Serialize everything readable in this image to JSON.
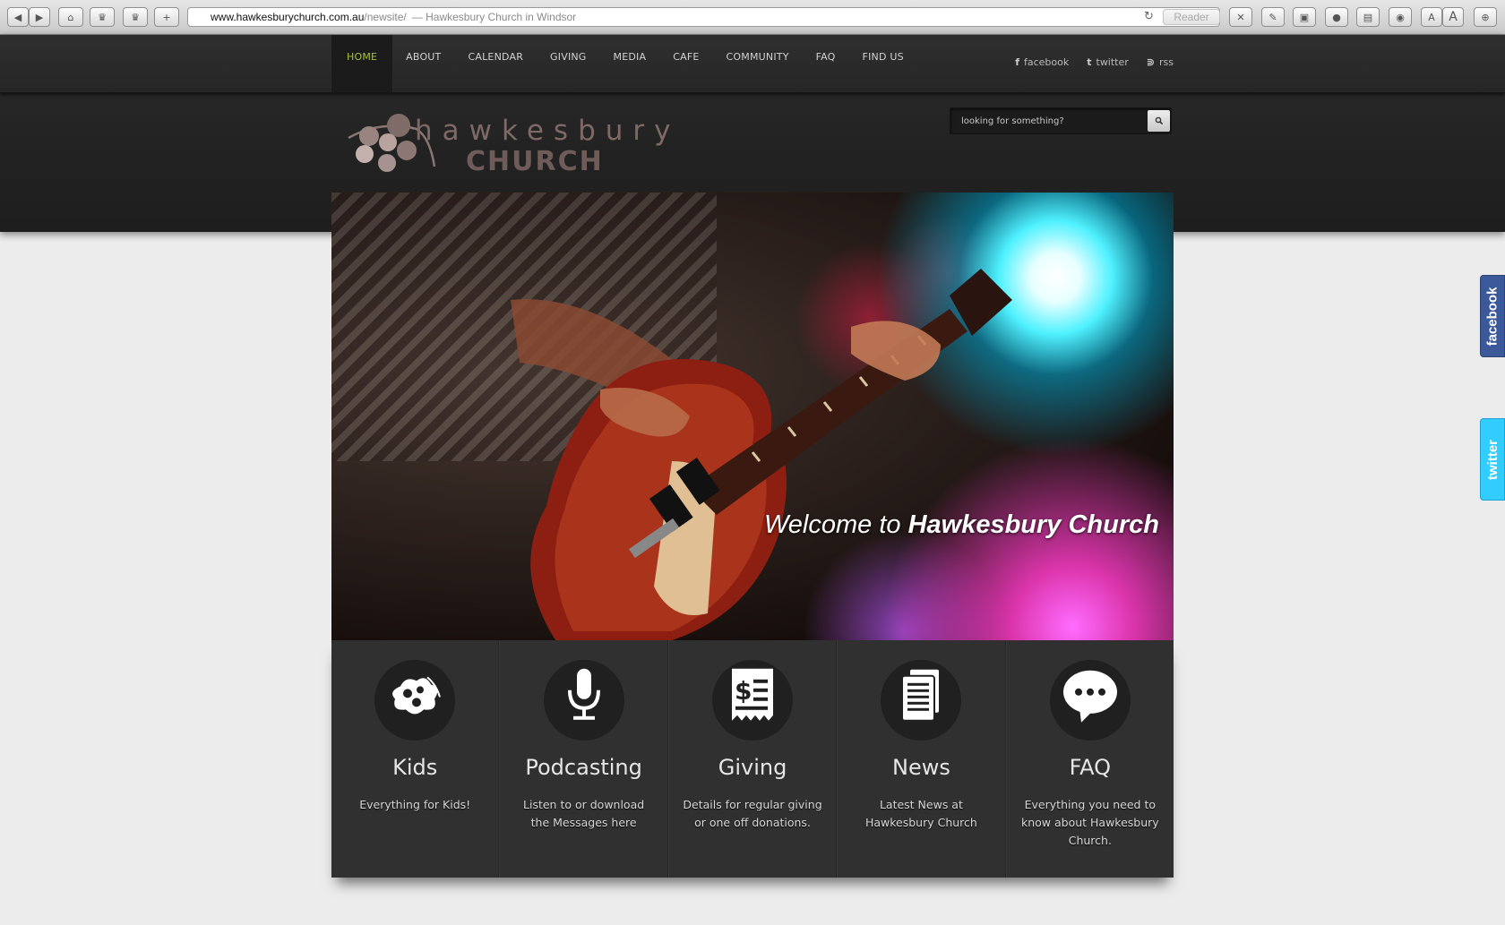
{
  "browser": {
    "url_host": "www.hawkesburychurch.com.au",
    "url_path": "/newsite/",
    "page_title": "— Hawkesbury Church in Windsor",
    "reader_label": "Reader"
  },
  "nav": {
    "items": [
      {
        "label": "HOME",
        "active": true
      },
      {
        "label": "ABOUT"
      },
      {
        "label": "CALENDAR"
      },
      {
        "label": "GIVING"
      },
      {
        "label": "MEDIA"
      },
      {
        "label": "CAFE"
      },
      {
        "label": "COMMUNITY"
      },
      {
        "label": "FAQ"
      },
      {
        "label": "FIND US"
      }
    ],
    "active_color": "#a6c338"
  },
  "social": {
    "facebook": "facebook",
    "twitter": "twitter",
    "rss": "rss"
  },
  "search": {
    "placeholder": "looking for something?"
  },
  "logo": {
    "line1": "hawkesbury",
    "line2": "CHURCH"
  },
  "hero": {
    "welcome_prefix": "Welcome to ",
    "welcome_name": "Hawkesbury Church"
  },
  "features": [
    {
      "title": "Kids",
      "desc": "Everything for Kids!",
      "icon": "splat-icon"
    },
    {
      "title": "Podcasting",
      "desc": "Listen to or download the Messages here",
      "icon": "microphone-icon"
    },
    {
      "title": "Giving",
      "desc": "Details for regular giving or one off donations.",
      "icon": "receipt-dollar-icon"
    },
    {
      "title": "News",
      "desc": "Latest News at Hawkesbury Church",
      "icon": "document-icon"
    },
    {
      "title": "FAQ",
      "desc": "Everything you need to know about Hawkesbury Church.",
      "icon": "speech-bubble-icon"
    }
  ],
  "side_tabs": {
    "facebook": "facebook",
    "twitter": "twitter",
    "facebook_color": "#3b5998",
    "twitter_color": "#33ccff"
  }
}
